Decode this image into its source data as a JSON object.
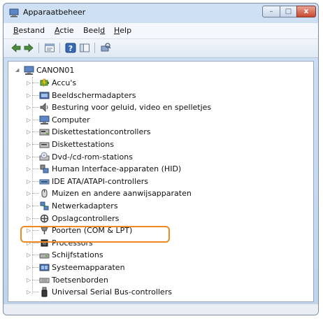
{
  "window": {
    "title": "Apparaatbeheer",
    "buttons": {
      "minimize": "–",
      "maximize": "□",
      "close": "x"
    }
  },
  "menu": [
    {
      "label": "Bestand",
      "accel_index": 0
    },
    {
      "label": "Actie",
      "accel_index": 0
    },
    {
      "label": "Beeld",
      "accel_index": 4
    },
    {
      "label": "Help",
      "accel_index": 0
    }
  ],
  "toolbar": {
    "icons": [
      "back-arrow-icon",
      "forward-arrow-icon",
      "properties-icon",
      "help-icon",
      "console-tree-icon",
      "scan-hardware-icon"
    ]
  },
  "tree": {
    "root": {
      "label": "CANON01",
      "expander": "◢",
      "icon": "computer-icon"
    },
    "items": [
      {
        "label": "Accu's",
        "icon": "battery-icon"
      },
      {
        "label": "Beeldschermadapters",
        "icon": "display-adapter-icon"
      },
      {
        "label": "Besturing voor geluid, video en spelletjes",
        "icon": "speaker-icon"
      },
      {
        "label": "Computer",
        "icon": "monitor-icon"
      },
      {
        "label": "Diskettestationcontrollers",
        "icon": "floppy-controller-icon"
      },
      {
        "label": "Diskettestations",
        "icon": "floppy-drive-icon"
      },
      {
        "label": "Dvd-/cd-rom-stations",
        "icon": "cd-drive-icon"
      },
      {
        "label": "Human Interface-apparaten (HID)",
        "icon": "hid-icon"
      },
      {
        "label": "IDE ATA/ATAPI-controllers",
        "icon": "ide-controller-icon"
      },
      {
        "label": "Muizen en andere aanwijsapparaten",
        "icon": "mouse-icon"
      },
      {
        "label": "Netwerkadapters",
        "icon": "network-icon"
      },
      {
        "label": "Opslagcontrollers",
        "icon": "storage-controller-icon"
      },
      {
        "label": "Poorten (COM & LPT)",
        "icon": "port-icon"
      },
      {
        "label": "Processors",
        "icon": "processor-icon"
      },
      {
        "label": "Schijfstations",
        "icon": "disk-drive-icon"
      },
      {
        "label": "Systeemapparaten",
        "icon": "system-device-icon"
      },
      {
        "label": "Toetsenborden",
        "icon": "keyboard-icon"
      },
      {
        "label": "Universal Serial Bus-controllers",
        "icon": "usb-icon",
        "highlighted": true
      }
    ],
    "collapsed_expander": "▷"
  },
  "colors": {
    "highlight": "#f08a1c",
    "title_bar": "#c6d9ef",
    "close_button": "#c8482f"
  }
}
